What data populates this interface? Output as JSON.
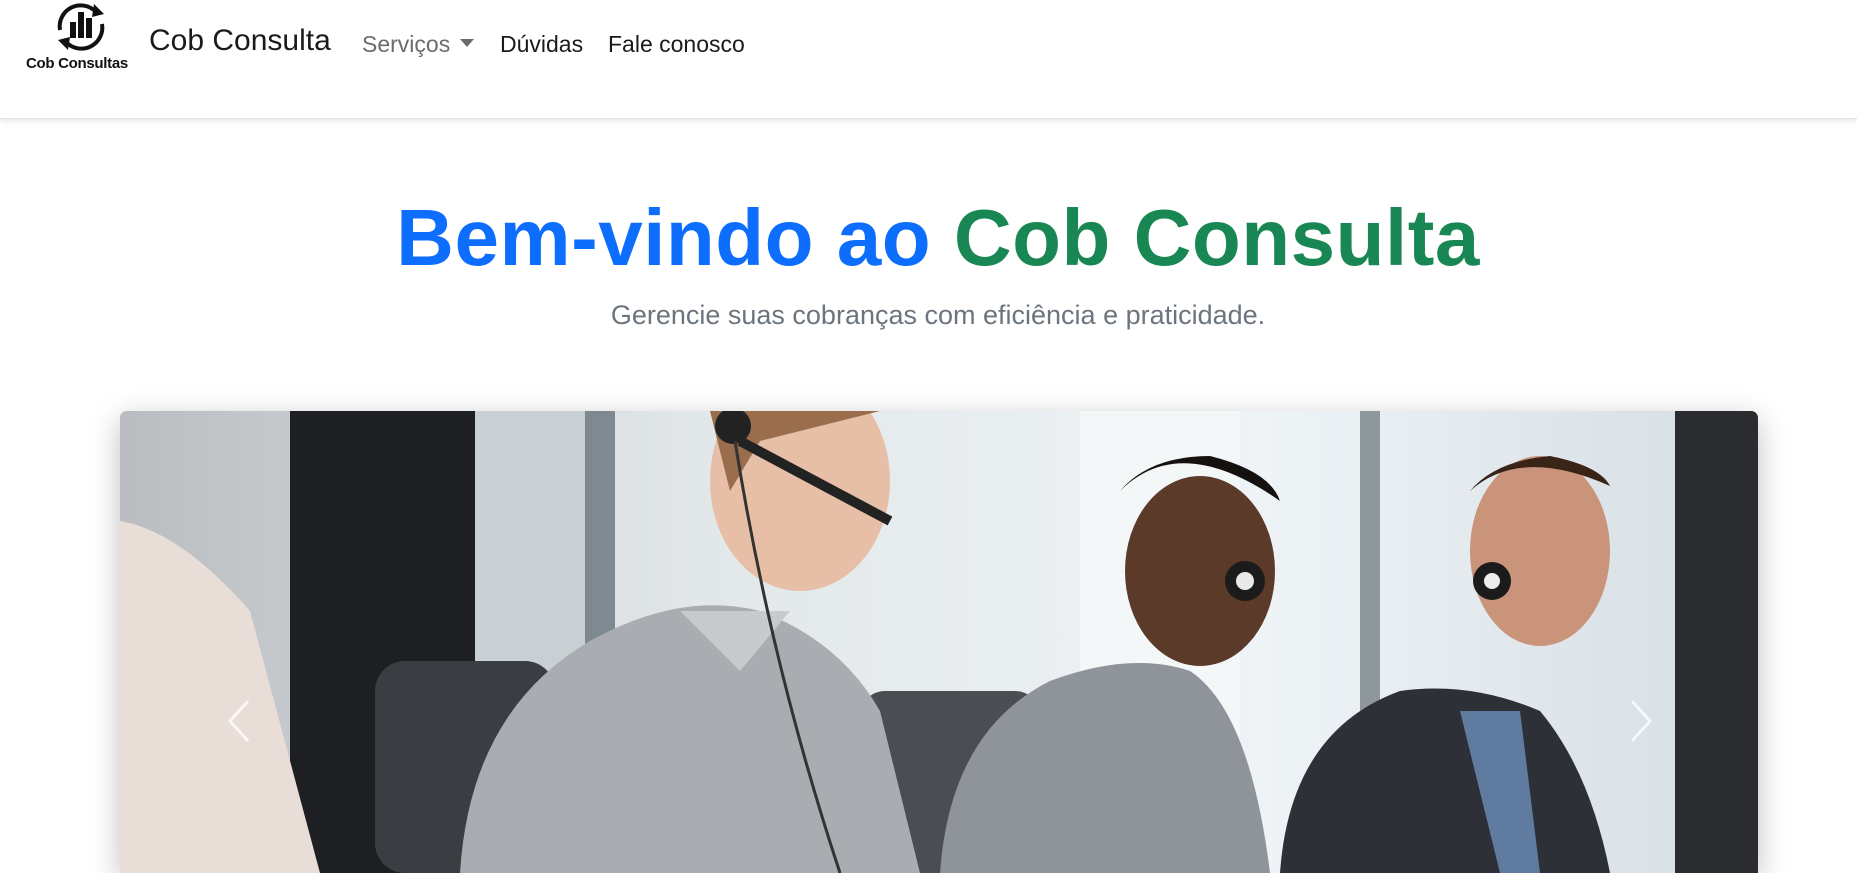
{
  "navbar": {
    "logo_text": "Cob Consultas",
    "brand_name": "Cob Consulta",
    "items": [
      {
        "label": "Serviços",
        "has_dropdown": true
      },
      {
        "label": "Dúvidas"
      },
      {
        "label": "Fale conosco"
      }
    ]
  },
  "hero": {
    "title_part1": "Bem-vindo ao",
    "title_part2": "Cob Consulta",
    "subtitle": "Gerencie suas cobranças com eficiência e praticidade."
  },
  "carousel": {
    "image_subject": "call-center agents with headsets",
    "prev_icon": "chevron-left-icon",
    "next_icon": "chevron-right-icon"
  },
  "colors": {
    "primary": "#0d6efd",
    "success": "#198754",
    "muted": "#6c757d",
    "nav_muted": "#6b6b6b"
  }
}
